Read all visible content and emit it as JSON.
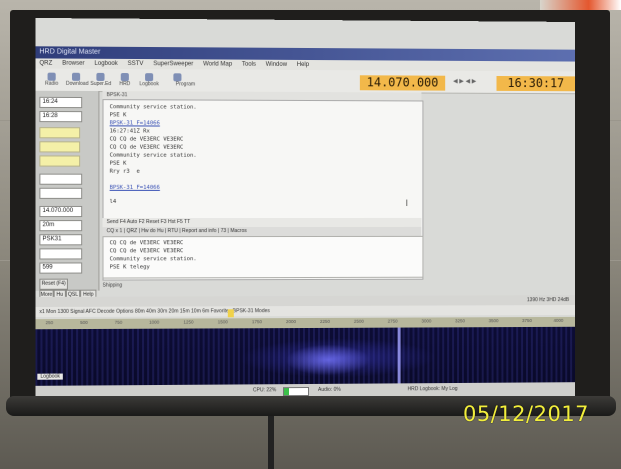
{
  "frequency": "14.070.000",
  "clock": "16:30:17",
  "date_stamp": "05/12/2017",
  "titlebar": "HRD Digital Master",
  "menu": [
    "QRZ",
    "Browser",
    "Logbook",
    "SSTV",
    "SuperSweeper",
    "World Map",
    "Tools",
    "Window",
    "Help"
  ],
  "toolbar": [
    "Radio",
    "Download",
    "Super.Ed",
    "HRD",
    "Logbook",
    "Program Options"
  ],
  "left_panel": {
    "time1": "16:24",
    "time2": "16:28",
    "freq": "14.070.000",
    "band": "20m",
    "mode": "PSK31",
    "rst": "599",
    "buttons": [
      "Reset (F4)",
      "More",
      "Hu",
      "QSL",
      "Help"
    ]
  },
  "editor_tab": "BPSK-31",
  "rx_lines": [
    {
      "text": "Community service station.",
      "link": false
    },
    {
      "text": "PSE K",
      "link": false
    },
    {
      "text": "BPSK-31 F=14066",
      "link": true
    },
    {
      "text": "16:27:41Z Rx",
      "link": false
    },
    {
      "text": "CQ CQ de VE3ERC VE3ERC",
      "link": false
    },
    {
      "text": "CQ CQ de VE3ERC VE3ERC",
      "link": false
    },
    {
      "text": "Community service station.",
      "link": false
    },
    {
      "text": "PSE K",
      "link": false
    },
    {
      "text": "Rry r3  e",
      "link": false
    },
    {
      "text": "BPSK-31 F=14066",
      "link": true
    },
    {
      "text": "l4",
      "link": false
    }
  ],
  "tx_bar": "Send  F4   Auto  F2   Reset  F3   Hst  F5   TT",
  "macro_bar": "CQ x 1 | QRZ | Hw do Hu | RTU | Report and info | 73 | Macros",
  "tx_lines": [
    "CQ CQ de VE3ERC VE3ERC",
    "CQ CQ de VE3ERC VE3ERC",
    "Community service station.",
    "PSE K telegy"
  ],
  "shipping": "Shipping",
  "spec_top": "1390 Hz   3HD  24dB",
  "spec_controls": "x1  Mon  1300  Signal  AFC  Decode  Options  80m 40m 30m 20m 15m 10m 6m  Favorites  BPSK-31  Modes",
  "scale": [
    "250",
    "500",
    "750",
    "1000",
    "1250",
    "1500",
    "1750",
    "2000",
    "2250",
    "2500",
    "2750",
    "3000",
    "3250",
    "3500",
    "3750",
    "4000"
  ],
  "logbook_tab": "Logbook",
  "cpu_label": "CPU: 22%",
  "cpu_percent": 22,
  "audio_label": "Audio: 0%",
  "hrd_log": "HRD Logbook: My Log",
  "colors": {
    "accent": "#f2b84a",
    "waterfall": "#0c0c35",
    "stamp": "#f2ee3c"
  }
}
